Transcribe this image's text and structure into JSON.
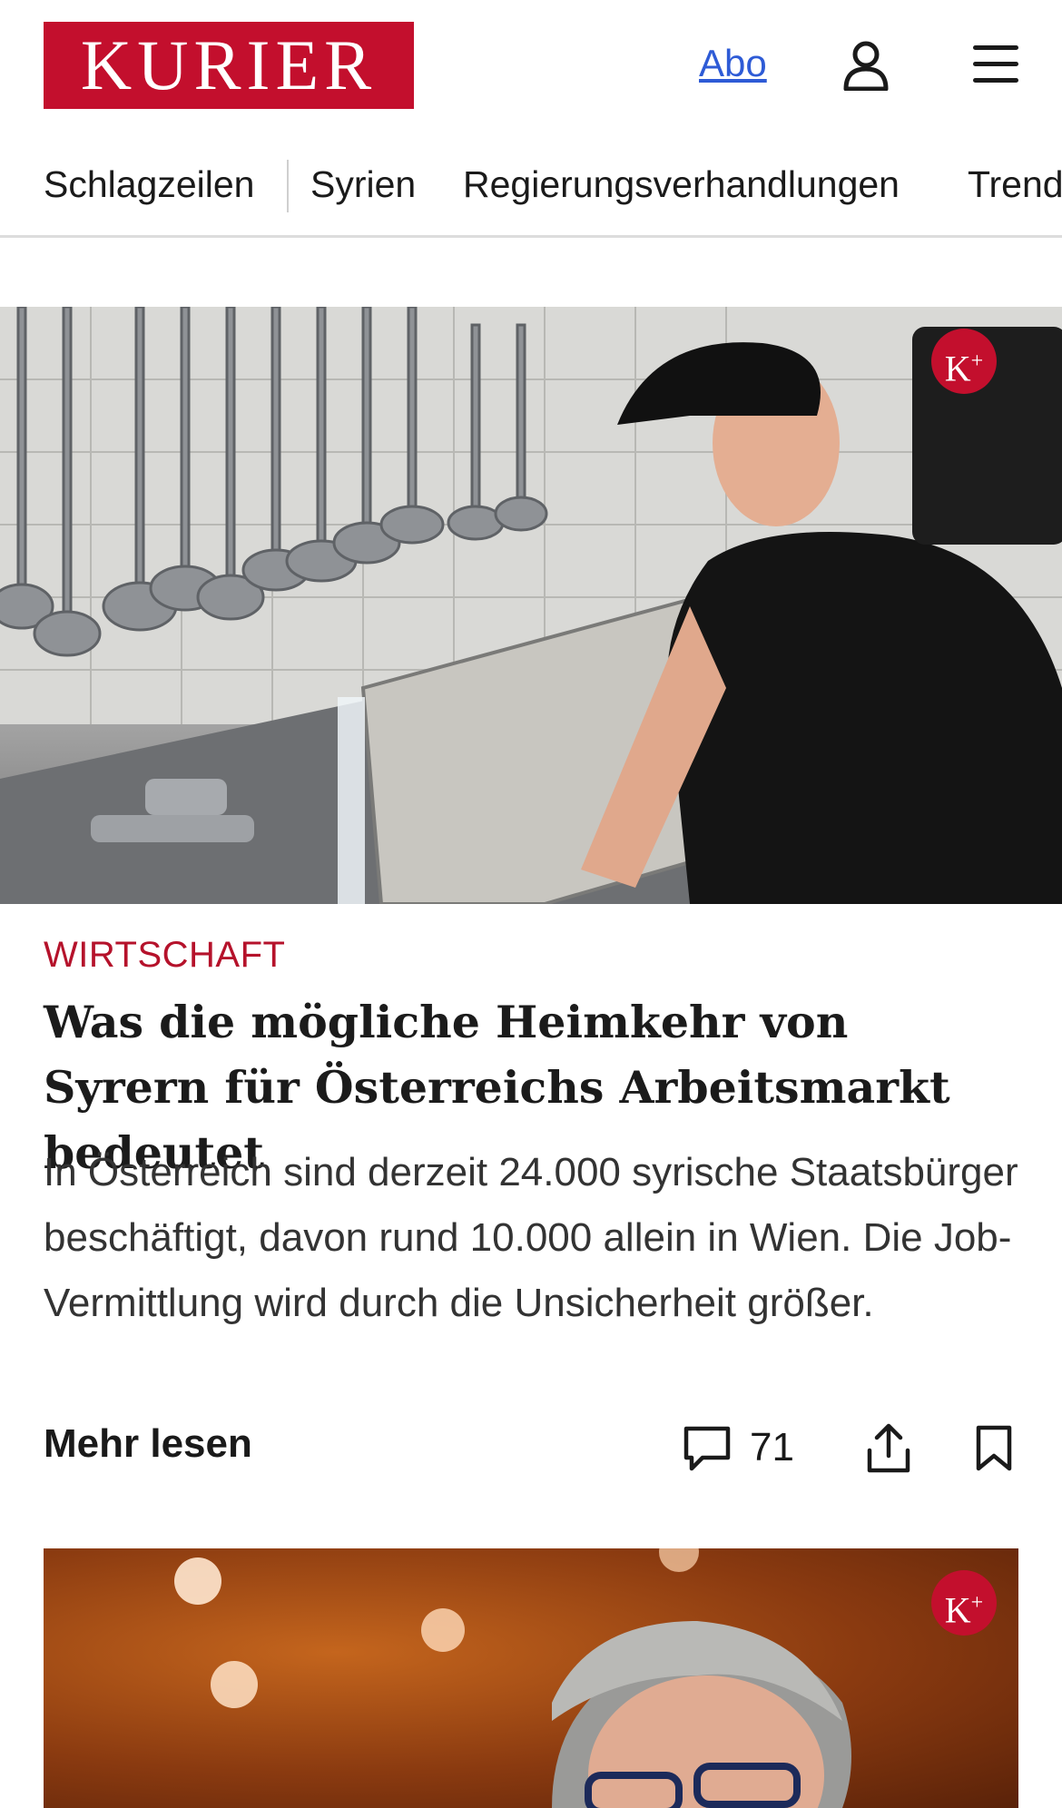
{
  "header": {
    "logo_text": "KURIER",
    "abo_label": "Abo",
    "icons": {
      "account": "user-icon",
      "menu": "hamburger-menu-icon"
    },
    "brand_color": "#c30f2d"
  },
  "nav": {
    "items": [
      {
        "label": "Schlagzeilen"
      },
      {
        "label": "Syrien"
      },
      {
        "label": "Regierungsverhandlungen"
      },
      {
        "label": "Trend"
      }
    ]
  },
  "articles": [
    {
      "image_alt": "Kitchen worker in black cap and t-shirt washing a tray at a stainless steel sink with hanging ladles",
      "premium_badge": "K+",
      "category": "WIRTSCHAFT",
      "headline": "Was die mögliche Heimkehr von Syrern für Österreichs Arbeitsmarkt bedeutet",
      "teaser": "In Österreich sind derzeit 24.000 syrische Staatsbürger beschäftigt, davon rund 10.000 allein in Wien. Die Job-Vermittlung wird durch die Unsicherheit größer.",
      "more_label": "Mehr lesen",
      "comment_count": "71",
      "icons": {
        "comments": "comment-icon",
        "share": "share-icon",
        "bookmark": "bookmark-icon"
      }
    },
    {
      "image_alt": "Man with grey hair and glasses in front of warm orange background with bokeh lights",
      "premium_badge": "K+"
    }
  ],
  "colors": {
    "category": "#b5122b",
    "link": "#2e5bd6"
  }
}
